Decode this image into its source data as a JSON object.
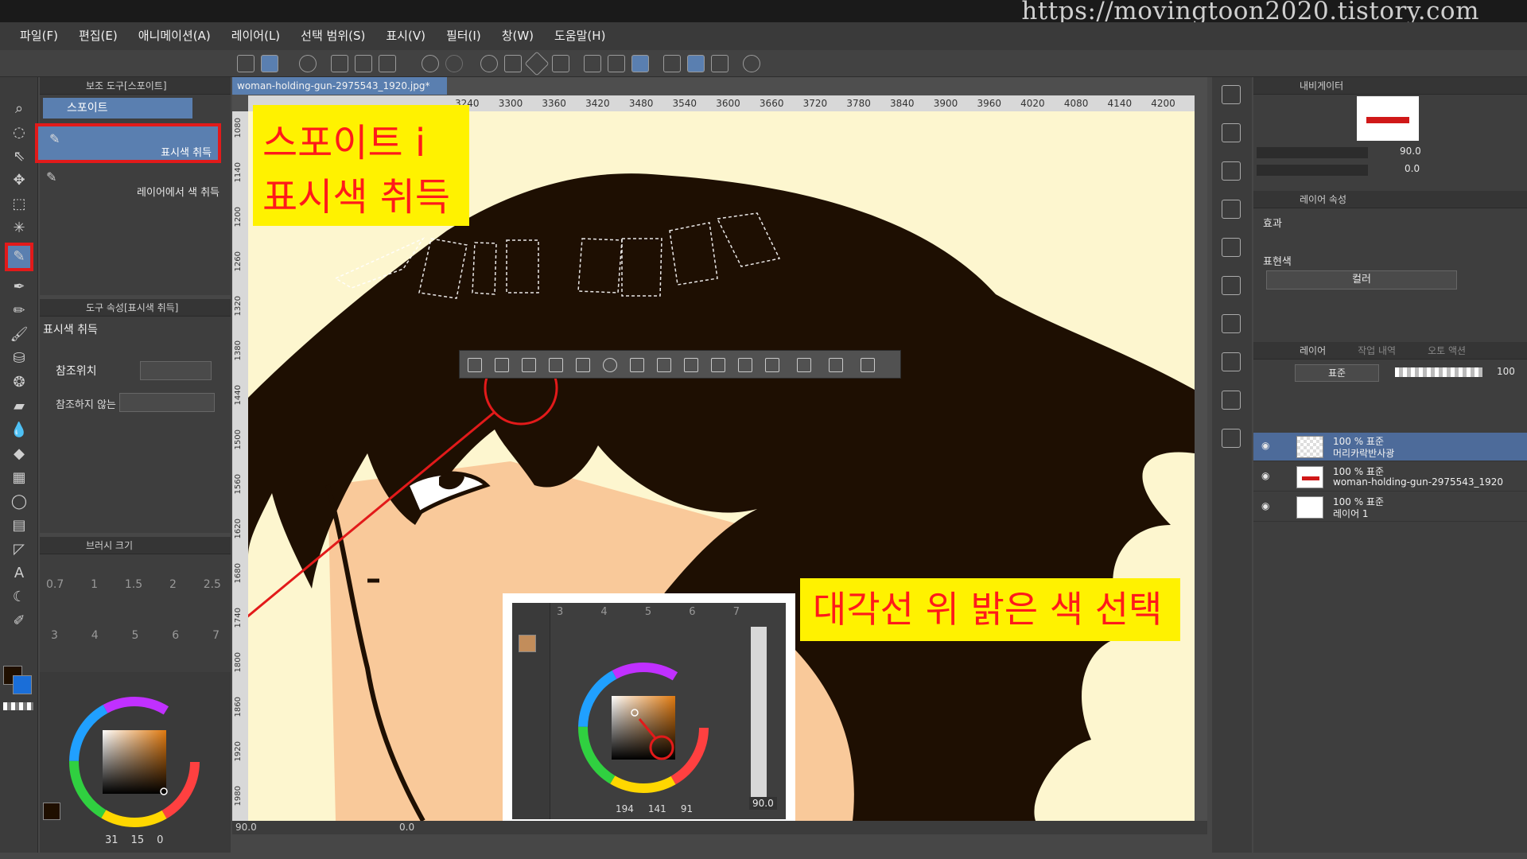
{
  "watermark": "https://movingtoon2020.tistory.com",
  "menu": [
    "파일(F)",
    "편집(E)",
    "애니메이션(A)",
    "레이어(L)",
    "선택 범위(S)",
    "표시(V)",
    "필터(I)",
    "창(W)",
    "도움말(H)"
  ],
  "subtool_panel": {
    "title": "보조 도구[스포이트]",
    "group": "스포이트",
    "items": [
      "표시색 취득",
      "레이어에서 색 취득"
    ]
  },
  "tool_property": {
    "title": "도구 속성[표시색 취득]",
    "tool_name": "표시색 취득",
    "reference_label": "참조위치",
    "not_reference_label": "참조하지 않는"
  },
  "brush_size": {
    "title": "브러시 크기",
    "row1": [
      "0.7",
      "1",
      "1.5",
      "2",
      "2.5"
    ],
    "row2": [
      "3",
      "4",
      "5",
      "6",
      "7"
    ]
  },
  "color": {
    "rgb": [
      "31",
      "15",
      "0"
    ],
    "inset_rgb": [
      "194",
      "141",
      "91"
    ],
    "main": "#1f0f00",
    "sub": "#1a6ed8",
    "inset_main": "#c28d5b"
  },
  "document": {
    "tab": "woman-holding-gun-2975543_1920.jpg*",
    "ruler_top": [
      "3240",
      "3300",
      "3360",
      "3420",
      "3480",
      "3540",
      "3600",
      "3660",
      "3720",
      "3780",
      "3840",
      "3900",
      "3960",
      "4020",
      "4080",
      "4140",
      "4200"
    ],
    "ruler_left": [
      "1080",
      "1140",
      "1200",
      "1260",
      "1320",
      "1380",
      "1440",
      "1500",
      "1560",
      "1620",
      "1680",
      "1740",
      "1800",
      "1860",
      "1920",
      "1980"
    ],
    "zoom": "90.0",
    "rotation": "0.0"
  },
  "inset": {
    "brush_row": [
      "3",
      "4",
      "5",
      "6",
      "7"
    ],
    "ruler_left": [
      "1800",
      "1860",
      "1920",
      "1980"
    ],
    "zoom": "90.0"
  },
  "annotations": {
    "title_line1": "스포이트 i",
    "title_line2": "표시색 취득",
    "note": "대각선 위 밝은 색 선택",
    "step": "7"
  },
  "navigator": {
    "tabs": [
      "내비게이터"
    ],
    "zoom": "90.0",
    "rotation": "0.0"
  },
  "layer_property": {
    "title": "레이어 속성",
    "effect_label": "효과",
    "expression_label": "표현색",
    "expression_value": "컬러"
  },
  "layers": {
    "tabs": [
      "레이어",
      "작업 내역",
      "오토 액션"
    ],
    "blend": "표준",
    "opacity": "100",
    "items": [
      {
        "line1": "100 % 표준",
        "line2": "머리카락반사광"
      },
      {
        "line1": "100 % 표준",
        "line2": "woman-holding-gun-2975543_1920"
      },
      {
        "line1": "100 % 표준",
        "line2": "레이어 1"
      }
    ]
  }
}
